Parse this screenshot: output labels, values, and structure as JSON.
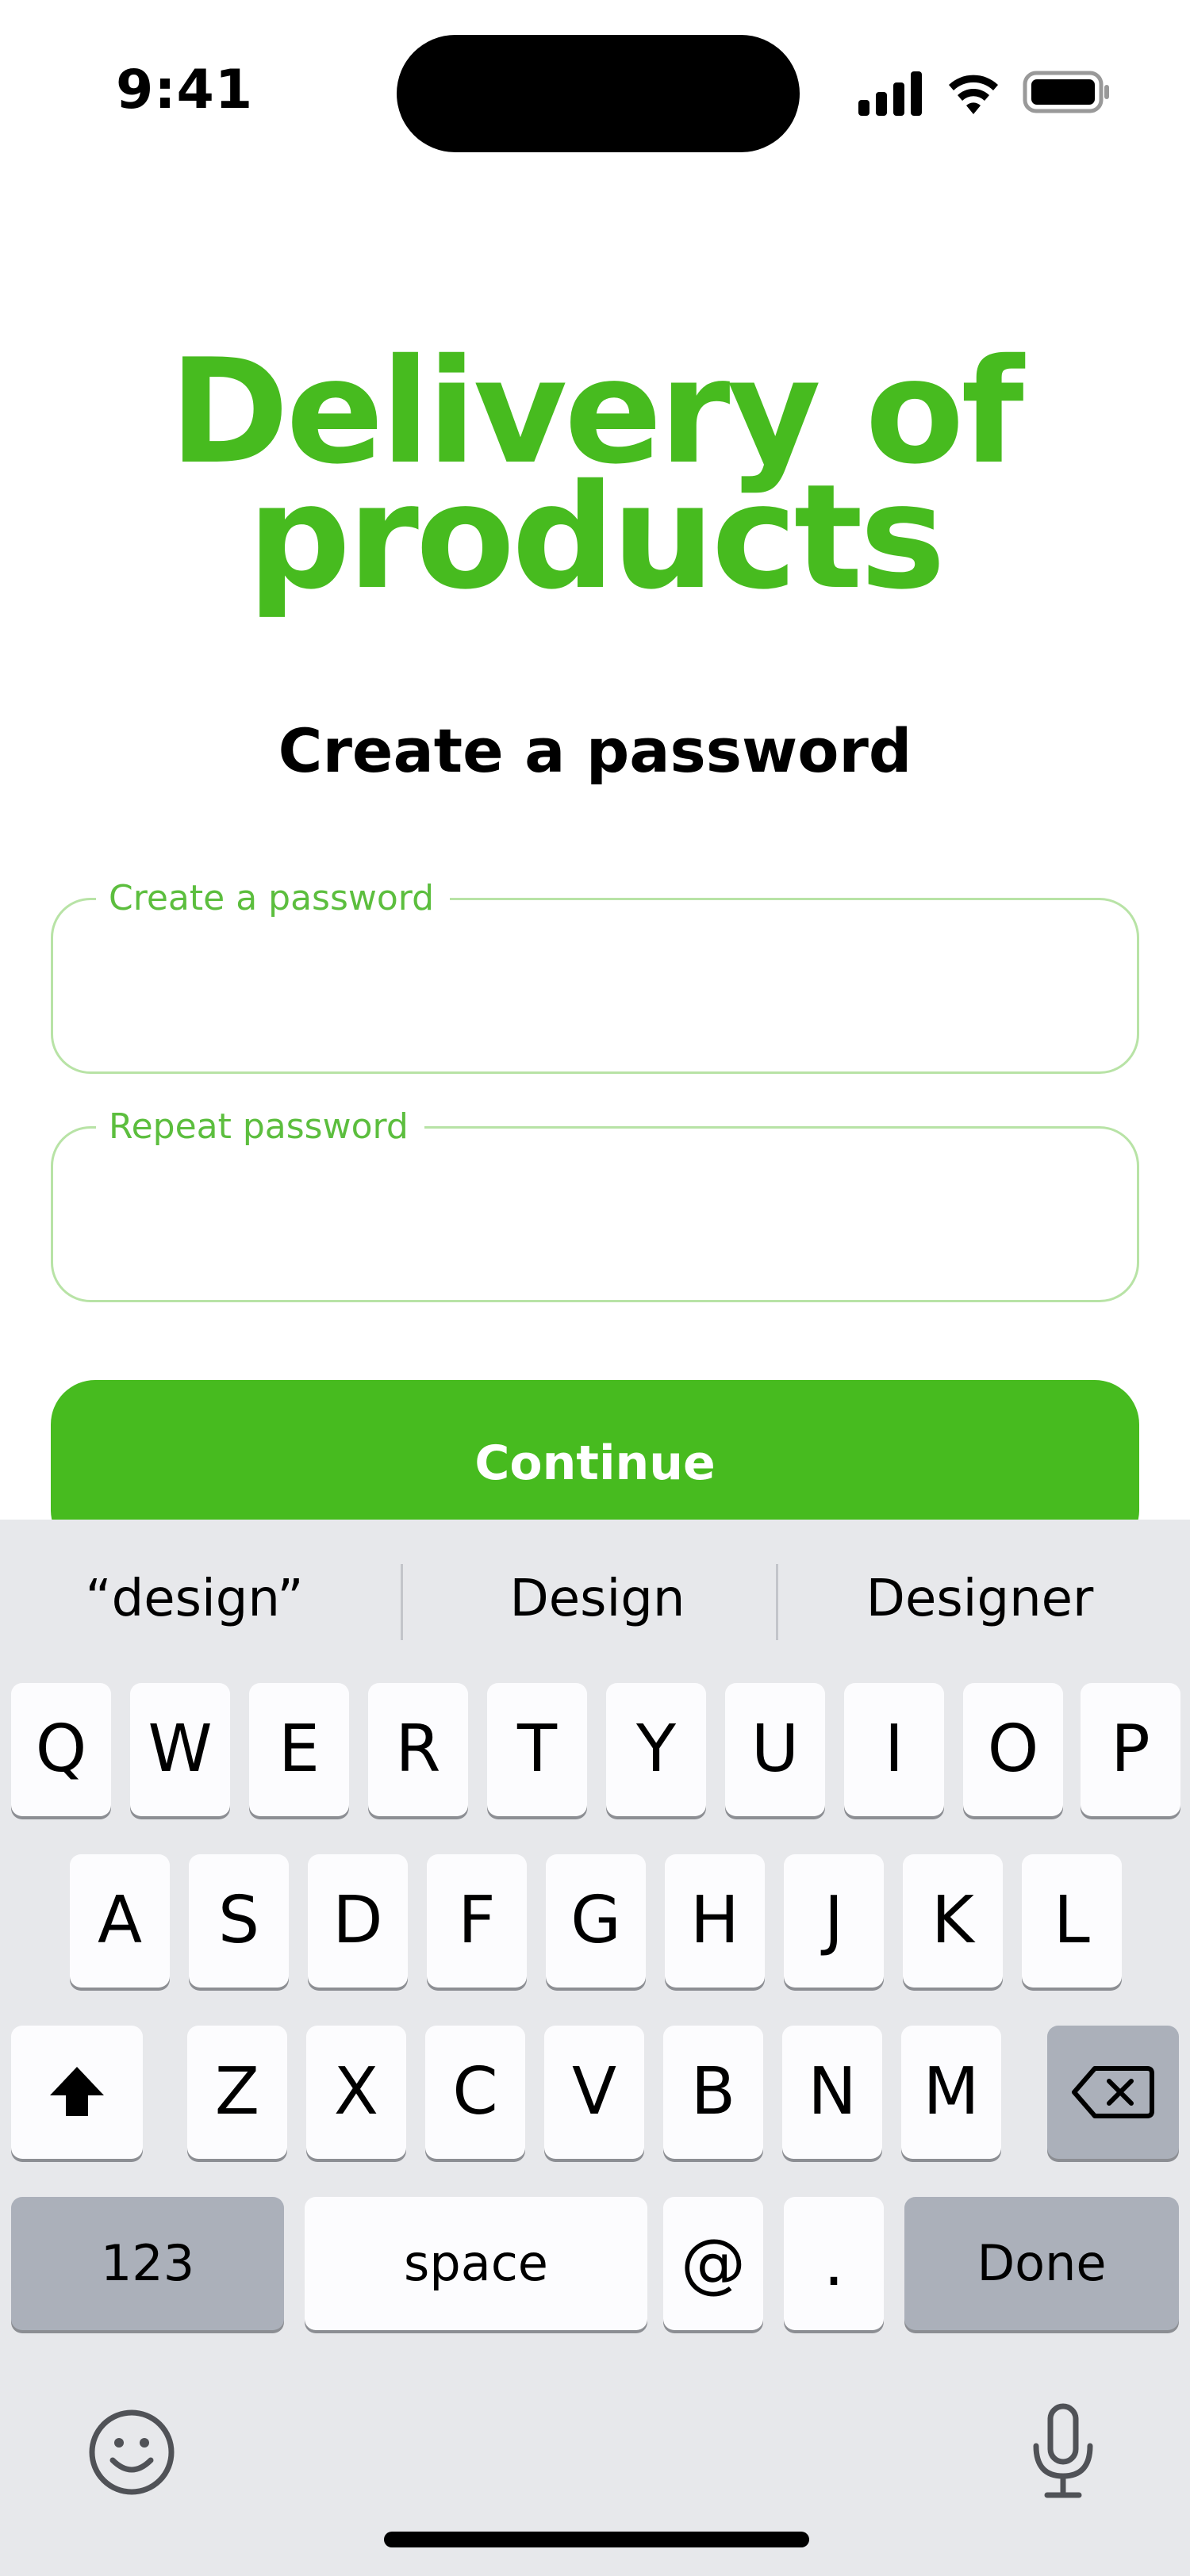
{
  "status_bar": {
    "time": "9:41"
  },
  "header": {
    "title_line1": "Delivery of",
    "title_line2": "products",
    "subtitle": "Create a password"
  },
  "form": {
    "password_label": "Create a password",
    "repeat_label": "Repeat password",
    "continue_label": "Continue"
  },
  "colors": {
    "accent": "#47BB1F",
    "field_border": "#B8E3A6",
    "label": "#5CBE3E"
  },
  "keyboard": {
    "suggestions": [
      "“design”",
      "Design",
      "Designer"
    ],
    "row1": [
      "Q",
      "W",
      "E",
      "R",
      "T",
      "Y",
      "U",
      "I",
      "O",
      "P"
    ],
    "row2": [
      "A",
      "S",
      "D",
      "F",
      "G",
      "H",
      "J",
      "K",
      "L"
    ],
    "row3": [
      "Z",
      "X",
      "C",
      "V",
      "B",
      "N",
      "M"
    ],
    "numbers_label": "123",
    "space_label": "space",
    "at_label": "@",
    "dot_label": ".",
    "done_label": "Done",
    "icons": [
      "shift-icon",
      "backspace-icon",
      "emoji-icon",
      "microphone-icon"
    ]
  }
}
